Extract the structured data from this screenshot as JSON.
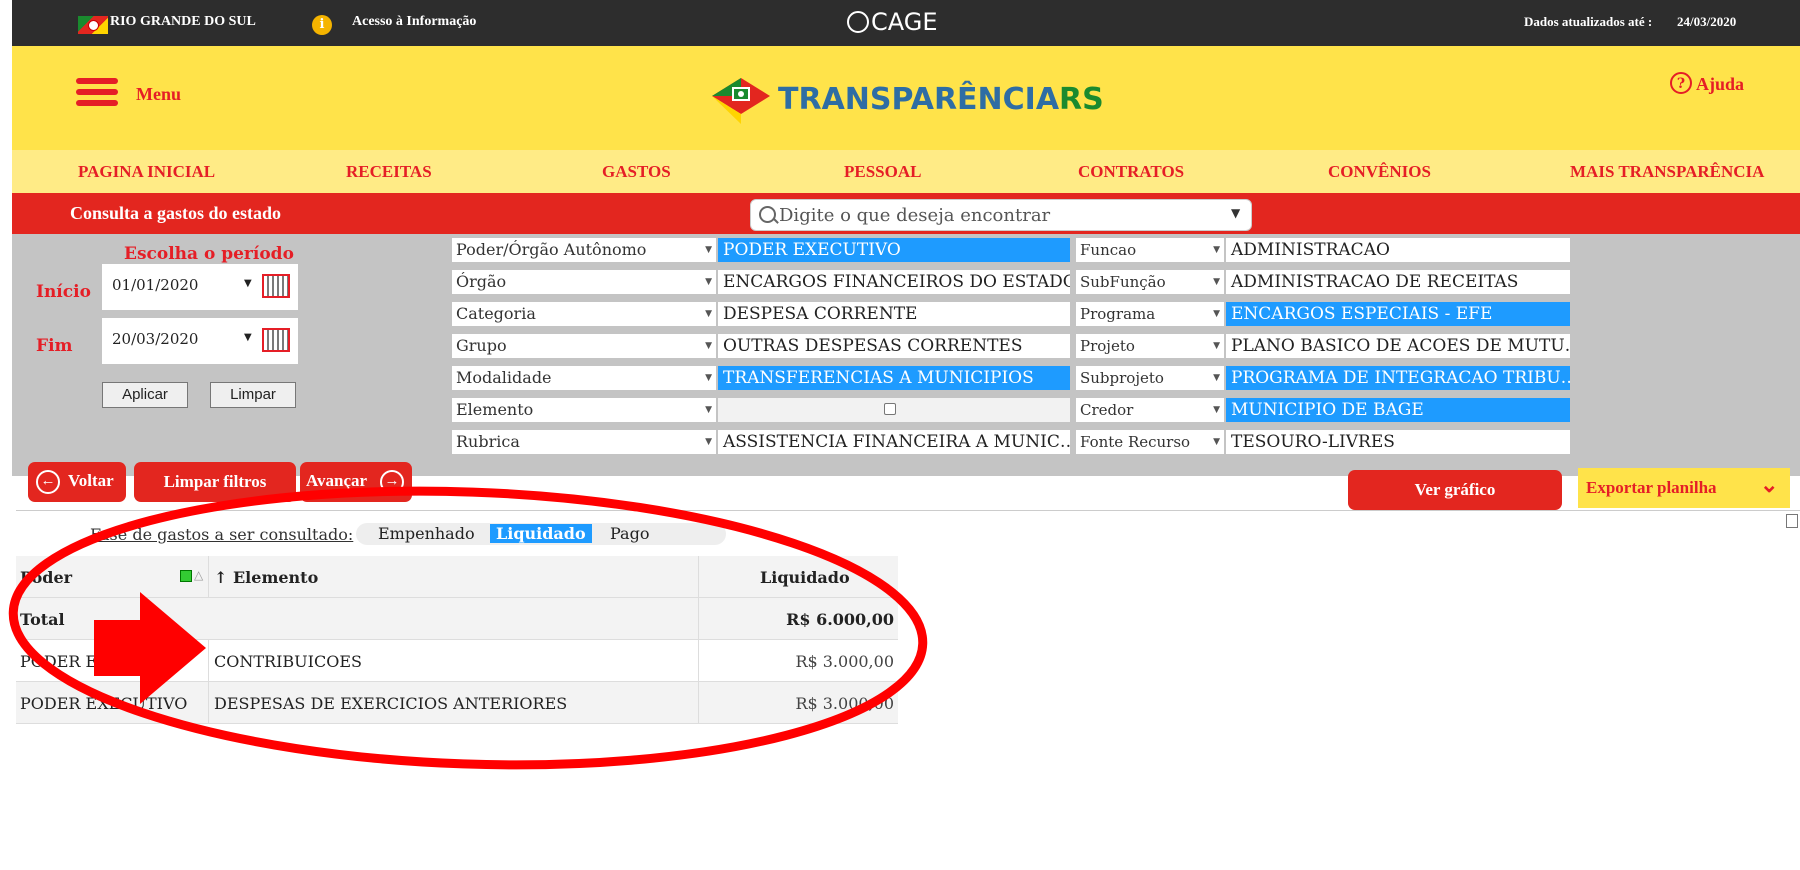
{
  "topbar": {
    "state": "RIO GRANDE DO SUL",
    "access": "Acesso à Informação",
    "cage": "CAGE",
    "updated_label": "Dados atualizados até :",
    "updated_date": "24/03/2020"
  },
  "header": {
    "menu_label": "Menu",
    "logo_part1": "TRANSPARÊNCIA",
    "logo_part2": "RS",
    "help_label": "Ajuda"
  },
  "nav": [
    "PAGINA INICIAL",
    "RECEITAS",
    "GASTOS",
    "PESSOAL",
    "CONTRATOS",
    "CONVÊNIOS",
    "MAIS TRANSPARÊNCIA"
  ],
  "page_title": "Consulta a gastos do estado",
  "search": {
    "placeholder": "Digite o que deseja encontrar"
  },
  "period": {
    "title": "Escolha o período",
    "start_label": "Início",
    "start_value": "01/01/2020",
    "end_label": "Fim",
    "end_value": "20/03/2020",
    "apply": "Aplicar",
    "clear": "Limpar"
  },
  "filters_left": [
    {
      "label": "Poder/Órgão Autônomo",
      "value": "PODER EXECUTIVO",
      "selected": true
    },
    {
      "label": "Órgão",
      "value": "ENCARGOS FINANCEIROS DO ESTADO",
      "selected": false
    },
    {
      "label": "Categoria",
      "value": "DESPESA CORRENTE",
      "selected": false
    },
    {
      "label": "Grupo",
      "value": "OUTRAS DESPESAS CORRENTES",
      "selected": false
    },
    {
      "label": "Modalidade",
      "value": "TRANSFERENCIAS A MUNICIPIOS",
      "selected": true
    },
    {
      "label": "Elemento",
      "value": "",
      "selected": false
    },
    {
      "label": "Rubrica",
      "value": "ASSISTENCIA FINANCEIRA A MUNIC…",
      "selected": false
    }
  ],
  "filters_right": [
    {
      "label": "Funcao",
      "value": "ADMINISTRACAO",
      "selected": false
    },
    {
      "label": "SubFunção",
      "value": "ADMINISTRACAO DE RECEITAS",
      "selected": false
    },
    {
      "label": "Programa",
      "value": "ENCARGOS ESPECIAIS - EFE",
      "selected": true
    },
    {
      "label": "Projeto",
      "value": "PLANO BASICO DE ACOES DE MUTU…",
      "selected": false
    },
    {
      "label": "Subprojeto",
      "value": "PROGRAMA DE INTEGRACAO TRIBU…",
      "selected": true
    },
    {
      "label": "Credor",
      "value": "MUNICIPIO DE BAGE",
      "selected": true
    },
    {
      "label": "Fonte Recurso",
      "value": "TESOURO-LIVRES",
      "selected": false
    }
  ],
  "actions": {
    "back": "Voltar",
    "clear_filters": "Limpar filtros",
    "forward": "Avançar",
    "chart": "Ver gráfico",
    "export": "Exportar planilha"
  },
  "phase": {
    "label": "Fase de gastos a ser consultado:",
    "options": [
      "Empenhado",
      "Liquidado",
      "Pago"
    ],
    "active": "Liquidado"
  },
  "table": {
    "headers": {
      "col1": "Poder",
      "col2": "Elemento",
      "col3": "Liquidado"
    },
    "total": {
      "label": "Total",
      "value": "R$ 6.000,00"
    },
    "rows": [
      {
        "poder": "PODER EXECUTIVO",
        "elemento": "CONTRIBUICOES",
        "valor": "R$ 3.000,00"
      },
      {
        "poder": "PODER EXECUTIVO",
        "elemento": "DESPESAS DE EXERCICIOS ANTERIORES",
        "valor": "R$ 3.000,00"
      }
    ]
  },
  "colors": {
    "red": "#e3261f",
    "yellow": "#ffe34a",
    "blue": "#1e9bff",
    "gray": "#c4c4c4",
    "dark": "#2d2d2d"
  }
}
